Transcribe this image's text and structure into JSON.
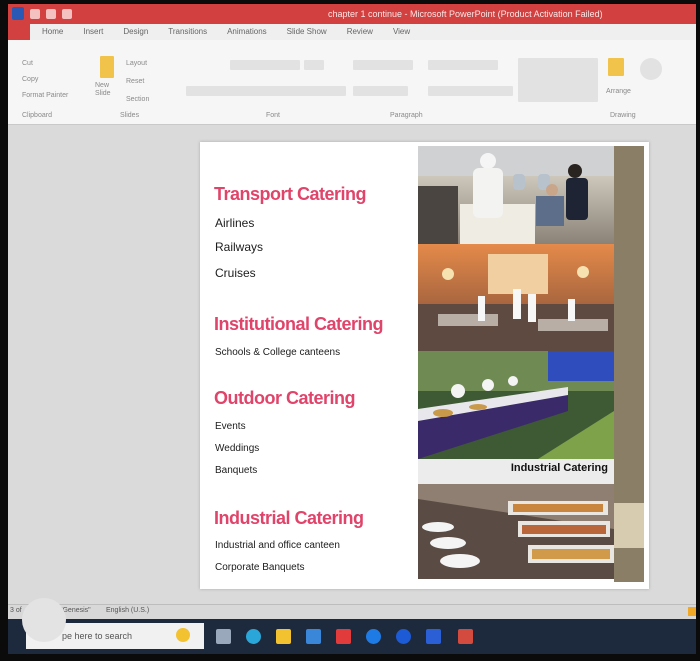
{
  "window": {
    "title": "chapter 1 continue - Microsoft PowerPoint (Product Activation Failed)"
  },
  "ribbon": {
    "tabs": [
      "Home",
      "Insert",
      "Design",
      "Transitions",
      "Animations",
      "Slide Show",
      "Review",
      "View"
    ],
    "groups": [
      "Clipboard",
      "Slides",
      "Font",
      "Paragraph",
      "Drawing"
    ],
    "slides_group": {
      "new_slide": "New Slide",
      "layout": "Layout",
      "reset": "Reset",
      "section": "Section"
    },
    "clipboard_group": {
      "cut": "Cut",
      "copy": "Copy",
      "format_painter": "Format Painter"
    },
    "arrange": "Arrange"
  },
  "slide": {
    "sections": [
      {
        "heading": "Transport Catering",
        "items": [
          "Airlines",
          "Railways",
          "Cruises"
        ]
      },
      {
        "heading": "Institutional Catering",
        "items": [
          "Schools & College canteens"
        ]
      },
      {
        "heading": "Outdoor Catering",
        "items": [
          "Events",
          "Weddings",
          "Banquets"
        ]
      },
      {
        "heading": "Industrial Catering",
        "items": [
          "Industrial and office canteen",
          "Corporate Banquets"
        ]
      }
    ],
    "photo_caption": "Industrial Catering"
  },
  "status_bar": {
    "slide_info": "3 of",
    "theme": "\"Genesis\"",
    "language": "English (U.S.)"
  },
  "taskbar": {
    "search_placeholder": "pe here to search"
  },
  "colors": {
    "title_bar": "#d24040",
    "heading": "#e0446a",
    "taskbar": "#1d2a3d"
  }
}
